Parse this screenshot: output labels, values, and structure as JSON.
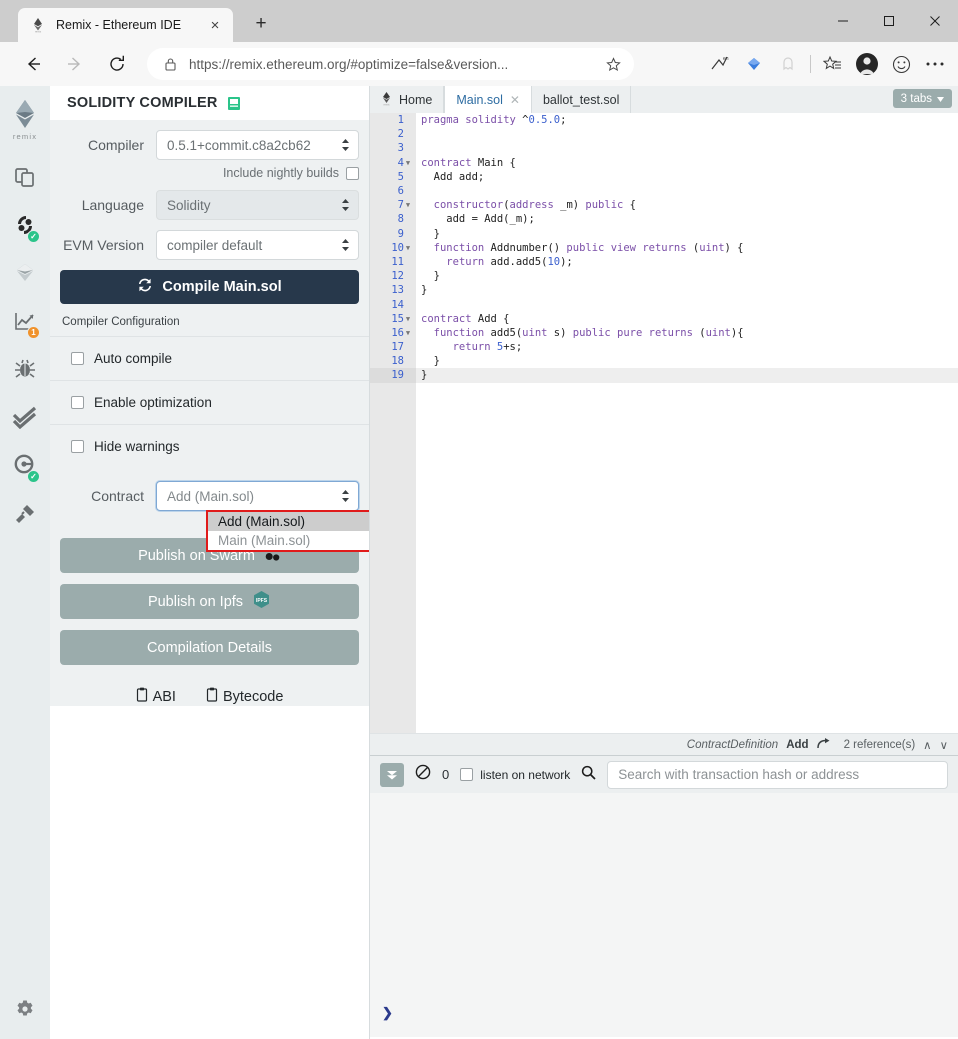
{
  "browser": {
    "tab": {
      "title": "Remix - Ethereum IDE",
      "favicon": "ethereum-remix-icon",
      "close": "×"
    },
    "newtab_label": "+",
    "window_controls": {
      "minimize": "—",
      "maximize": "☐",
      "close": "✕"
    },
    "toolbar": {
      "back": "back-arrow-icon",
      "forward": "forward-arrow-icon",
      "reload": "reload-icon",
      "lock": "lock-icon",
      "url": "https://remix.ethereum.org/#optimize=false&version...",
      "star": "favorite-star-icon",
      "icons": [
        "collections-icon",
        "diamond-icon",
        "ghost-icon",
        "favorites-list-icon",
        "profile-avatar",
        "feedback-smiley-icon",
        "more-options-icon"
      ]
    }
  },
  "iconbar": {
    "logo_wordmark": "remix",
    "items": [
      {
        "name": "file-explorers-icon",
        "badge": null
      },
      {
        "name": "deploy-run-transactions-icon",
        "badge": "ok"
      },
      {
        "name": "solidity-compiler-icon",
        "badge": null
      },
      {
        "name": "analysis-icon",
        "badge": "1"
      },
      {
        "name": "debugger-icon",
        "badge": null
      },
      {
        "name": "solidity-unit-testing-icon",
        "badge": null
      },
      {
        "name": "settings-compiler-icon",
        "badge": "ok"
      },
      {
        "name": "plugin-manager-icon",
        "badge": null
      }
    ],
    "gear": "settings-gear-icon"
  },
  "sidepanel": {
    "title": "SOLIDITY COMPILER",
    "doc_icon": "documentation-book-icon",
    "compiler": {
      "label": "Compiler",
      "value": "0.5.1+commit.c8a2cb62"
    },
    "nightly": {
      "label": "Include nightly builds",
      "checked": false
    },
    "language": {
      "label": "Language",
      "value": "Solidity"
    },
    "evm": {
      "label": "EVM Version",
      "value": "compiler default"
    },
    "compile_button": {
      "label": "Compile Main.sol",
      "icon": "refresh-icon"
    },
    "config_title": "Compiler Configuration",
    "config_rows": [
      {
        "label": "Auto compile",
        "checked": false
      },
      {
        "label": "Enable optimization",
        "checked": false
      },
      {
        "label": "Hide warnings",
        "checked": false
      }
    ],
    "contract": {
      "label": "Contract",
      "value": "Add (Main.sol)",
      "options": [
        "Add (Main.sol)",
        "Main (Main.sol)"
      ],
      "selected_index": 0,
      "highlight_color": "#e01b1b"
    },
    "publish_swarm": {
      "label": "Publish on Swarm",
      "icon": "swarm-icon"
    },
    "publish_ipfs": {
      "label": "Publish on Ipfs",
      "icon": "ipfs-icon"
    },
    "compilation_details": {
      "label": "Compilation Details"
    },
    "abi": {
      "label": "ABI",
      "icon": "clipboard-icon"
    },
    "bytecode": {
      "label": "Bytecode",
      "icon": "clipboard-icon"
    }
  },
  "editor": {
    "tabs": [
      {
        "label": "Home",
        "icon": "ethereum-home-icon",
        "active": false,
        "closable": false
      },
      {
        "label": "Main.sol",
        "active": true,
        "closable": true
      },
      {
        "label": "ballot_test.sol",
        "active": false,
        "closable": false
      }
    ],
    "tab_count_label": "3 tabs",
    "current_line": 19,
    "lines": [
      {
        "n": 1,
        "fold": false,
        "text": "pragma solidity ^0.5.0;"
      },
      {
        "n": 2,
        "fold": false,
        "text": ""
      },
      {
        "n": 3,
        "fold": false,
        "text": ""
      },
      {
        "n": 4,
        "fold": true,
        "text": "contract Main {"
      },
      {
        "n": 5,
        "fold": false,
        "text": "  Add add;"
      },
      {
        "n": 6,
        "fold": false,
        "text": ""
      },
      {
        "n": 7,
        "fold": true,
        "text": "  constructor(address _m) public {"
      },
      {
        "n": 8,
        "fold": false,
        "text": "    add = Add(_m);"
      },
      {
        "n": 9,
        "fold": false,
        "text": "  }"
      },
      {
        "n": 10,
        "fold": true,
        "text": "  function Addnumber() public view returns (uint) {"
      },
      {
        "n": 11,
        "fold": false,
        "text": "    return add.add5(10);"
      },
      {
        "n": 12,
        "fold": false,
        "text": "  }"
      },
      {
        "n": 13,
        "fold": false,
        "text": "}"
      },
      {
        "n": 14,
        "fold": false,
        "text": ""
      },
      {
        "n": 15,
        "fold": true,
        "text": "contract Add {"
      },
      {
        "n": 16,
        "fold": true,
        "text": "  function add5(uint s) public pure returns (uint){"
      },
      {
        "n": 17,
        "fold": false,
        "text": "     return 5+s;"
      },
      {
        "n": 18,
        "fold": false,
        "text": "  }"
      },
      {
        "n": 19,
        "fold": false,
        "text": "}"
      }
    ],
    "refbar": {
      "kind": "ContractDefinition",
      "name": "Add",
      "jump_icon": "jump-to-reference-icon",
      "references": "2 reference(s)",
      "up": "∧",
      "down": "∨"
    }
  },
  "terminal": {
    "toggle_icon": "double-chevron-down-icon",
    "block_icon": "no-transactions-icon",
    "count": "0",
    "listen_label": "listen on network",
    "listen_checked": false,
    "search_icon": "search-icon",
    "search_placeholder": "Search with transaction hash or address",
    "prompt": "❯"
  }
}
